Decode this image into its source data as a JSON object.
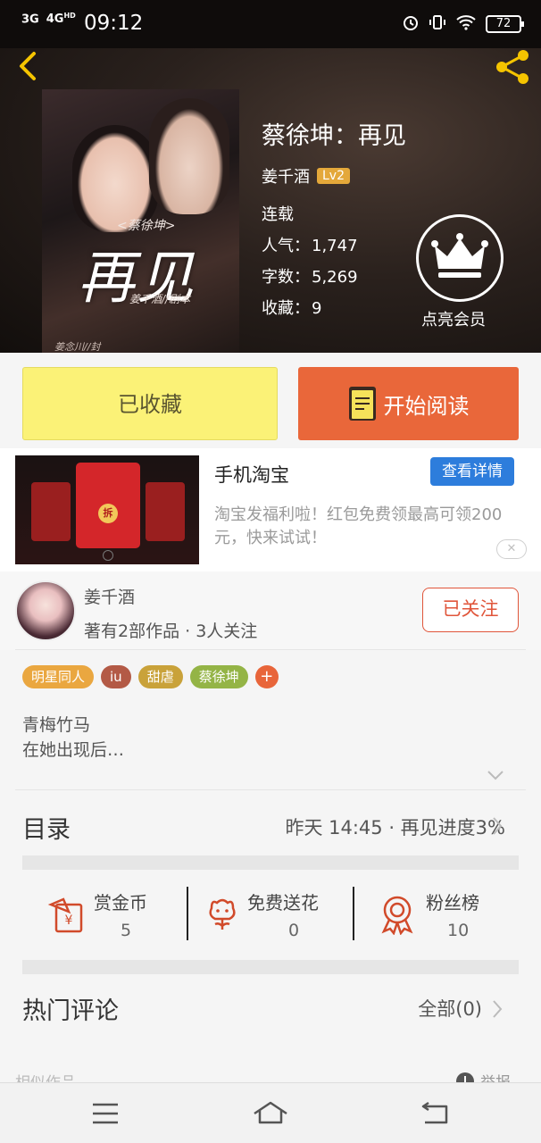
{
  "status_bar": {
    "net1": "3G",
    "net2": "4G",
    "net2_sup": "HD",
    "time": "09:12",
    "battery": "72"
  },
  "book": {
    "title": "蔡徐坤：再见",
    "author": "姜千酒",
    "level": "Lv2",
    "status": "连载",
    "popularity_label": "人气：",
    "popularity": "1,747",
    "words_label": "字数：",
    "words": "5,269",
    "favorites_label": "收藏：",
    "favorites": "9",
    "vip_label": "点亮会员",
    "cover": {
      "sub": "<蔡徐坤>",
      "big": "再见",
      "credit": "姜千酒//剧本",
      "credit2": "姜念川//封"
    }
  },
  "actions": {
    "favorited": "已收藏",
    "start_reading": "开始阅读"
  },
  "ad": {
    "title": "手机淘宝",
    "detail": "查看详情",
    "desc": "淘宝发福利啦！红包免费领最高可领200元，快来试试！",
    "close": "✕",
    "img_char": "拆"
  },
  "author_card": {
    "name": "姜千酒",
    "stats": "著有2部作品 · 3人关注",
    "follow": "已关注"
  },
  "tags": [
    {
      "label": "明星同人",
      "color": "#eaa740"
    },
    {
      "label": "iu",
      "color": "#b35a46"
    },
    {
      "label": "甜虐",
      "color": "#c9a23a"
    },
    {
      "label": "蔡徐坤",
      "color": "#94b446"
    }
  ],
  "tag_more": "+",
  "intro": {
    "line1": "青梅竹马",
    "line2": "在她出现后…"
  },
  "toc": {
    "title": "目录",
    "meta": "昨天 14:45 · 再见进度3%"
  },
  "rewards": [
    {
      "label": "赏金币",
      "value": "5",
      "icon": "coin-envelope-icon"
    },
    {
      "label": "免费送花",
      "value": "0",
      "icon": "flower-icon"
    },
    {
      "label": "粉丝榜",
      "value": "10",
      "icon": "medal-icon"
    }
  ],
  "comments": {
    "title": "热门评论",
    "all": "全部(0)"
  },
  "peek": {
    "similar": "相似作品",
    "report": "举报"
  },
  "colors": {
    "accent_orange": "#e9673a",
    "favorite_yellow": "#fbf277",
    "link_blue": "#2d7ddc",
    "follow_red": "#e0553a"
  }
}
